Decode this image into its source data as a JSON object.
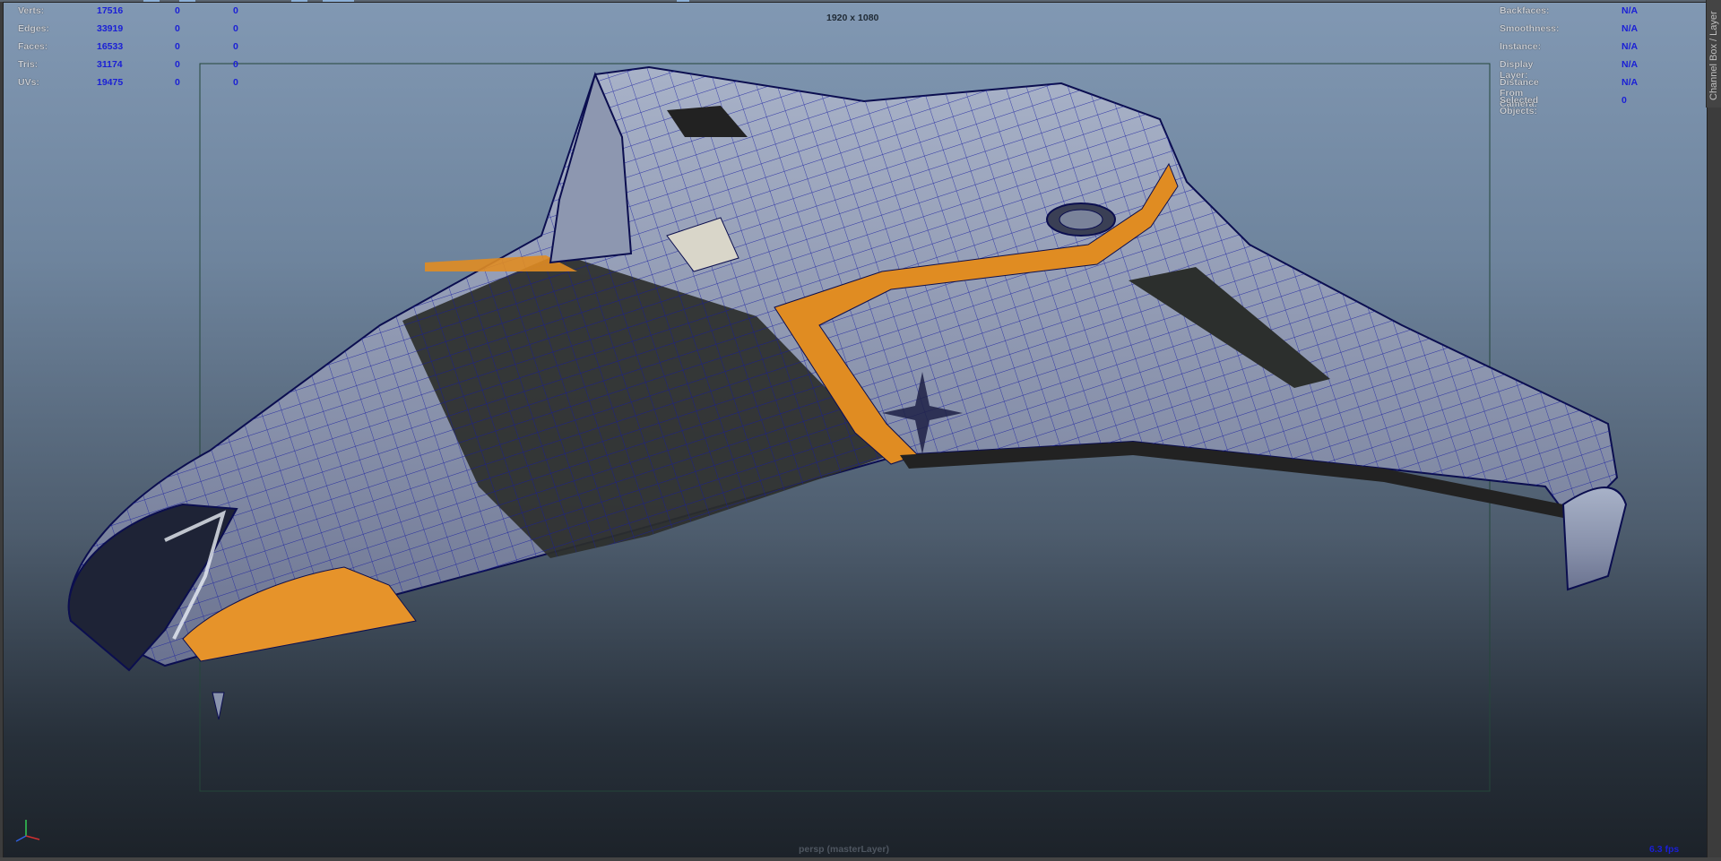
{
  "window": {
    "channel_box_tab": "Channel Box / Layer"
  },
  "viewport": {
    "resolution_gate": "1920 x 1080",
    "camera": "persp (masterLayer)",
    "fps": "6.3 fps"
  },
  "hud_left": [
    {
      "label": "Verts:",
      "v0": "17516",
      "v1": "0",
      "v2": "0"
    },
    {
      "label": "Edges:",
      "v0": "33919",
      "v1": "0",
      "v2": "0"
    },
    {
      "label": "Faces:",
      "v0": "16533",
      "v1": "0",
      "v2": "0"
    },
    {
      "label": "Tris:",
      "v0": "31174",
      "v1": "0",
      "v2": "0"
    },
    {
      "label": "UVs:",
      "v0": "19475",
      "v1": "0",
      "v2": "0"
    }
  ],
  "hud_right": [
    {
      "label": "Backfaces:",
      "value": "N/A"
    },
    {
      "label": "Smoothness:",
      "value": "N/A"
    },
    {
      "label": "Instance:",
      "value": "N/A"
    },
    {
      "label": "Display Layer:",
      "value": "N/A"
    },
    {
      "label": "Distance From Camera:",
      "value": "N/A"
    },
    {
      "label": "Selected Objects:",
      "value": "0"
    }
  ],
  "axis_gizmo": {
    "labels": [
      "y",
      "x",
      "z"
    ]
  },
  "colors": {
    "hull": "#8a94ad",
    "panel_dark": "#2c2f2d",
    "stripe_orange": "#e08c22",
    "wireframe": "#1a1fa0",
    "hud_value": "#1a1fd6"
  },
  "icons": [
    "axis-gizmo-icon",
    "spaceship-model"
  ]
}
